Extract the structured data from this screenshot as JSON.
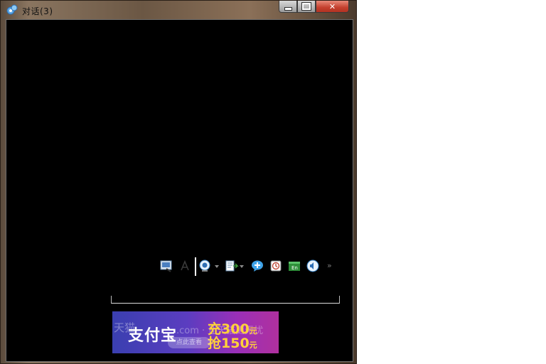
{
  "window": {
    "title": "对话(3)",
    "controls": {
      "minimize": "minimize",
      "maximize": "maximize",
      "close": "✕"
    }
  },
  "toolbar": {
    "items": [
      "screenshot-icon",
      "font-icon",
      "webcam-icon",
      "send-file-icon",
      "chat-bubble-icon",
      "history-icon",
      "translate-icon",
      "speaker-icon"
    ],
    "more": "»"
  },
  "ad": {
    "ghost_left": "天猫",
    "ghost_right": ".com · 让天猫更无忧",
    "brand": "支付宝",
    "line1": "充300",
    "line1_suffix": "元",
    "line2": "抢150",
    "line2_suffix": "元",
    "cta": "点此查看"
  }
}
